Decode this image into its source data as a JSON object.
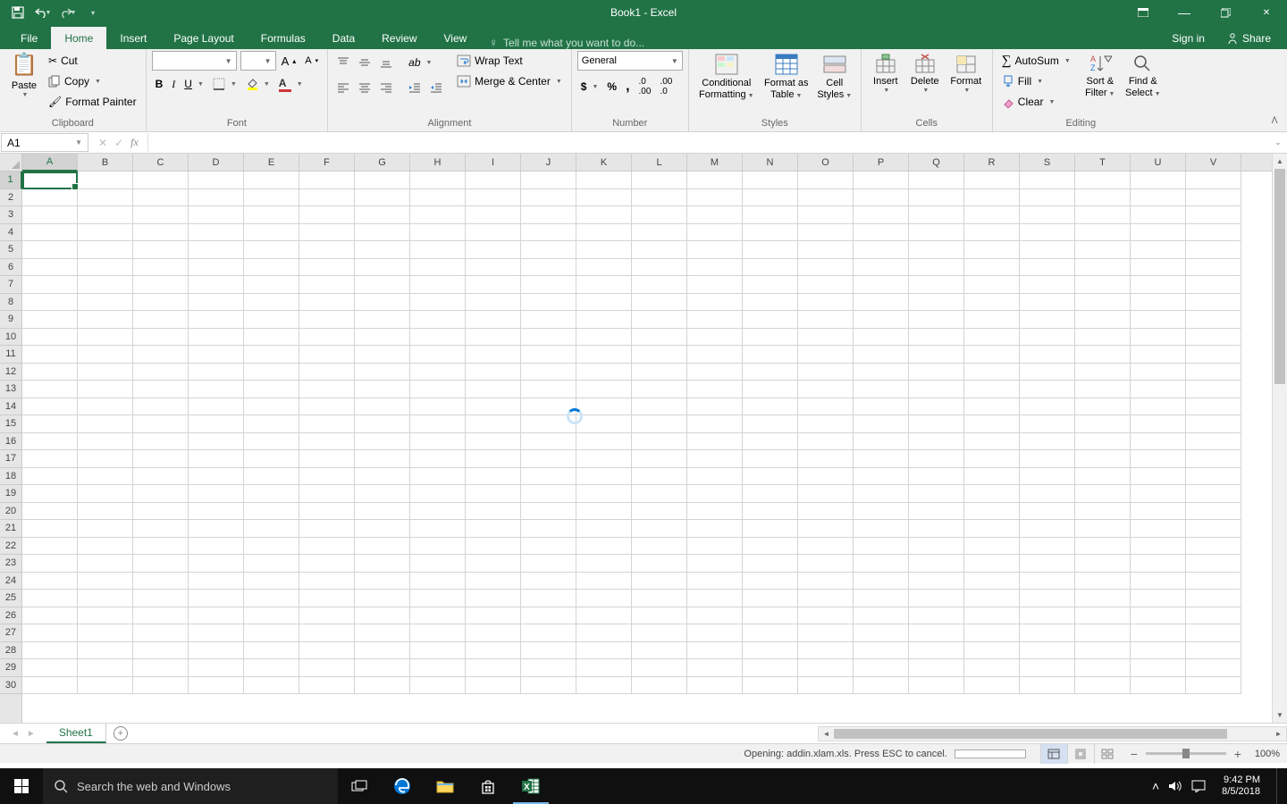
{
  "window": {
    "title": "Book1 - Excel",
    "min": "—",
    "max": "▭",
    "close": "✕"
  },
  "tabs": {
    "file": "File",
    "home": "Home",
    "insert": "Insert",
    "pagelayout": "Page Layout",
    "formulas": "Formulas",
    "data": "Data",
    "review": "Review",
    "view": "View",
    "tellme": "Tell me what you want to do...",
    "signin": "Sign in",
    "share": "Share"
  },
  "ribbon": {
    "clipboard": {
      "label": "Clipboard",
      "paste": "Paste",
      "cut": "Cut",
      "copy": "Copy",
      "fmtpainter": "Format Painter"
    },
    "font": {
      "label": "Font",
      "grow": "A",
      "shrink": "A",
      "bold": "B",
      "italic": "I",
      "underline": "U"
    },
    "alignment": {
      "label": "Alignment",
      "wrap": "Wrap Text",
      "merge": "Merge & Center"
    },
    "number": {
      "label": "Number",
      "format": "General"
    },
    "styles": {
      "label": "Styles",
      "cond": "Conditional Formatting",
      "table": "Format as Table",
      "cell": "Cell Styles"
    },
    "cells": {
      "label": "Cells",
      "insert": "Insert",
      "delete": "Delete",
      "format": "Format"
    },
    "editing": {
      "label": "Editing",
      "autosum": "AutoSum",
      "fill": "Fill",
      "clear": "Clear",
      "sort": "Sort & Filter",
      "find": "Find & Select"
    }
  },
  "namebox": "A1",
  "columns": [
    "A",
    "B",
    "C",
    "D",
    "E",
    "F",
    "G",
    "H",
    "I",
    "J",
    "K",
    "L",
    "M",
    "N",
    "O",
    "P",
    "Q",
    "R",
    "S",
    "T",
    "U",
    "V"
  ],
  "rows": [
    "1",
    "2",
    "3",
    "4",
    "5",
    "6",
    "7",
    "8",
    "9",
    "10",
    "11",
    "12",
    "13",
    "14",
    "15",
    "16",
    "17",
    "18",
    "19",
    "20",
    "21",
    "22",
    "23",
    "24",
    "25",
    "26",
    "27",
    "28",
    "29",
    "30"
  ],
  "sheets": {
    "active": "Sheet1"
  },
  "status": {
    "opening": "Opening: addin.xlam.xls. Press ESC to cancel.",
    "zoom": "100%"
  },
  "taskbar": {
    "search_placeholder": "Search the web and Windows",
    "time": "9:42 PM",
    "date": "8/5/2018"
  }
}
